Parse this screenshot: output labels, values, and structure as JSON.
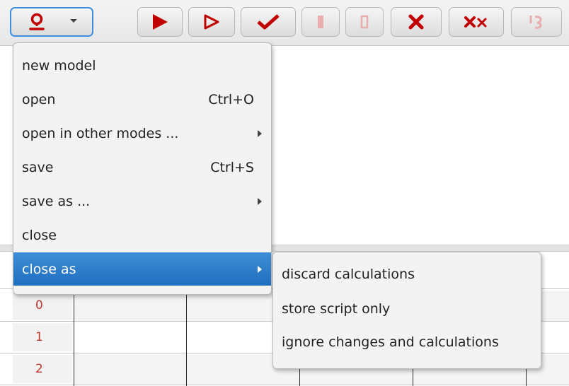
{
  "toolbar": {
    "model_icon": "model-user-icon",
    "buttons": [
      {
        "icon": "run-filled-icon",
        "enabled": true
      },
      {
        "icon": "run-outline-icon",
        "enabled": true
      },
      {
        "icon": "check-icon",
        "enabled": true
      },
      {
        "icon": "pause-filled-icon",
        "enabled": false
      },
      {
        "icon": "pause-outline-icon",
        "enabled": false
      },
      {
        "icon": "close-x-icon",
        "enabled": true
      },
      {
        "icon": "double-x-icon",
        "enabled": true
      },
      {
        "icon": "undo-icon",
        "enabled": false
      }
    ],
    "accent_color": "#c00000"
  },
  "menu": {
    "items": [
      {
        "label": "new model",
        "shortcut": "",
        "submenu": false
      },
      {
        "label": "open",
        "shortcut": "Ctrl+O",
        "submenu": false
      },
      {
        "label": "open in other modes ...",
        "shortcut": "",
        "submenu": true
      },
      {
        "label": "save",
        "shortcut": "Ctrl+S",
        "submenu": false
      },
      {
        "label": "save as ...",
        "shortcut": "",
        "submenu": true
      },
      {
        "label": "close",
        "shortcut": "",
        "submenu": false
      },
      {
        "label": "close as",
        "shortcut": "",
        "submenu": true,
        "selected": true
      }
    ],
    "selected_color": "#1f6fc0"
  },
  "submenu": {
    "items": [
      {
        "label": "discard calculations"
      },
      {
        "label": "store script only"
      },
      {
        "label": "ignore changes and calculations"
      }
    ]
  },
  "table": {
    "row_headers": [
      "0",
      "1",
      "2"
    ]
  }
}
